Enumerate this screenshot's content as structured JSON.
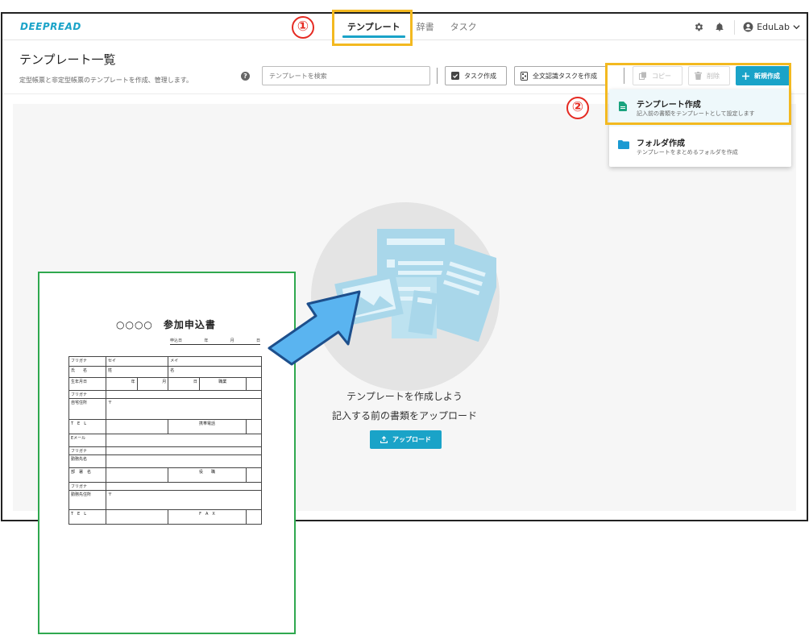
{
  "app": {
    "logo": "DEEPREAD",
    "nav": [
      {
        "label": "テンプレート",
        "active": true
      },
      {
        "label": "辞書",
        "active": false
      },
      {
        "label": "タスク",
        "active": false
      }
    ],
    "user": "EduLab",
    "accent_color": "#1aa3c8"
  },
  "page": {
    "title": "テンプレート一覧",
    "subtitle": "定型帳票と非定型帳票のテンプレートを作成、管理します。",
    "help_symbol": "?",
    "search_placeholder": "テンプレートを検索"
  },
  "toolbar": {
    "task_create": "タスク作成",
    "fulltext_task": "全文認識タスクを作成",
    "copy": "コピー",
    "delete": "削除",
    "new_create": "新規作成"
  },
  "menu": {
    "items": [
      {
        "title": "テンプレート作成",
        "subtitle": "記入前の書類をテンプレートとして設定します",
        "icon": "document-icon"
      },
      {
        "title": "フォルダ作成",
        "subtitle": "テンプレートをまとめるフォルダを作成",
        "icon": "folder-icon"
      }
    ]
  },
  "empty_state": {
    "title": "テンプレートを作成しよう",
    "subtitle": "記入する前の書類をアップロード",
    "upload_button": "アップロード"
  },
  "annotations": {
    "step1": "①",
    "step2": "②",
    "highlight_color": "#f3b920",
    "arrow_color": "#5ab4f0"
  },
  "document": {
    "title": "○○○○　参加申込書",
    "date": {
      "label": "申込日",
      "year": "年",
      "month": "月",
      "day": "日"
    },
    "rows": [
      {
        "label": "フリガナ",
        "cells": [
          "セイ",
          "メイ"
        ]
      },
      {
        "label": "氏　　名",
        "cells": [
          "姓",
          "名"
        ]
      },
      {
        "label": "生年月日",
        "cells": [
          "年",
          "月",
          "日",
          "職業",
          ""
        ]
      },
      {
        "label": "フリガナ",
        "cells": [
          ""
        ]
      },
      {
        "label": "自宅住所",
        "cells": [
          "〒"
        ]
      },
      {
        "label": "T　E　L",
        "cells": [
          "",
          "携帯電話",
          ""
        ]
      },
      {
        "label": "Eメール",
        "cells": [
          ""
        ]
      },
      {
        "label": "フリガナ",
        "cells": [
          ""
        ]
      },
      {
        "label": "勤務先名",
        "cells": [
          ""
        ]
      },
      {
        "label": "部　署　名",
        "cells": [
          "",
          "役　　職",
          ""
        ]
      },
      {
        "label": "フリガナ",
        "cells": [
          ""
        ]
      },
      {
        "label": "勤務先住所",
        "cells": [
          "〒"
        ]
      },
      {
        "label": "T　E　L",
        "cells": [
          "",
          "F　A　X",
          ""
        ]
      }
    ]
  }
}
